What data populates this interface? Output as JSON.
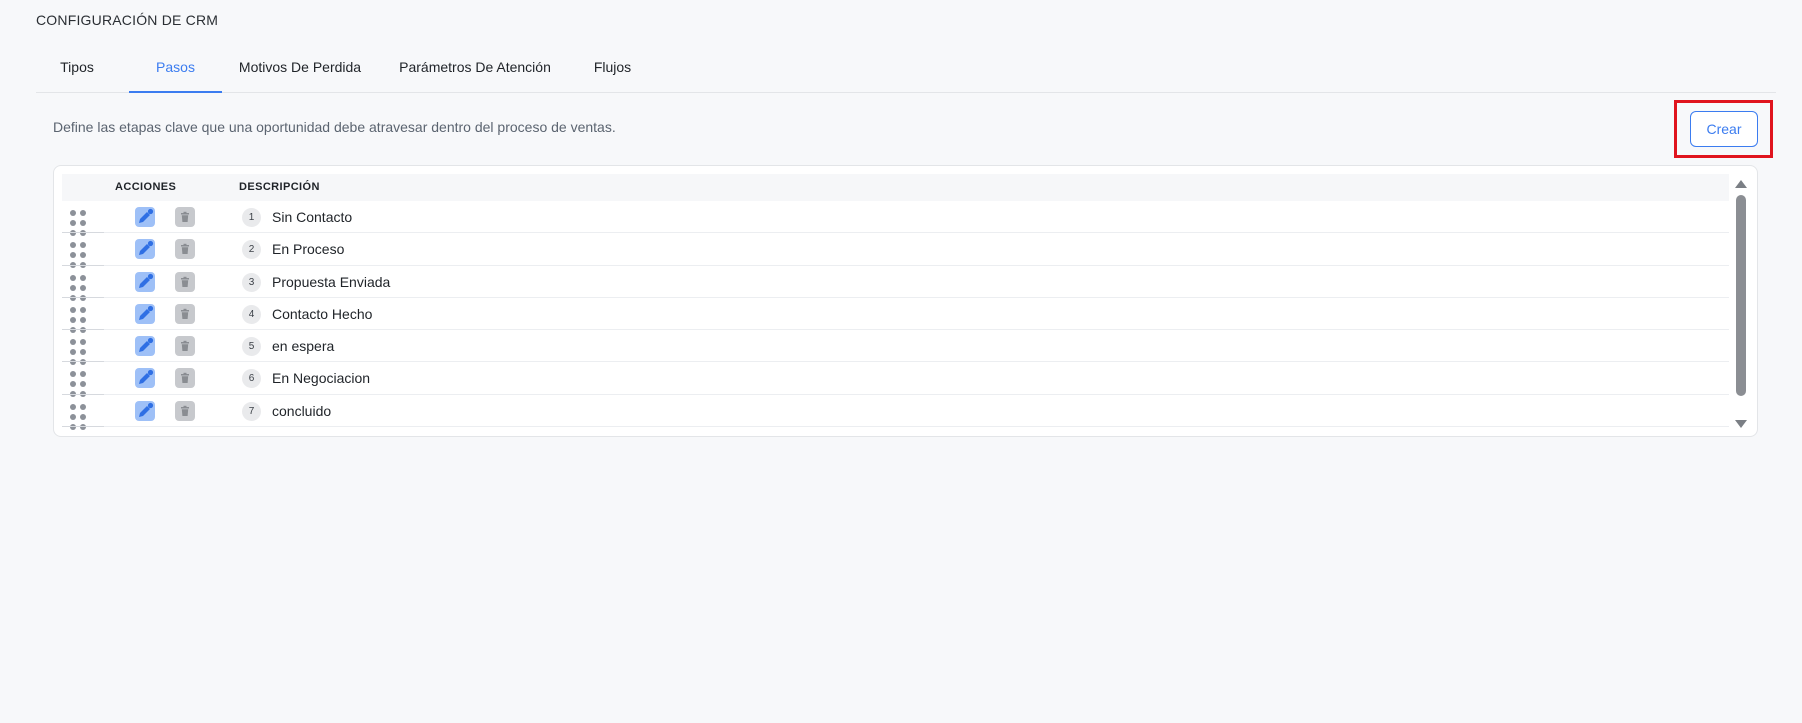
{
  "page": {
    "title": "CONFIGURACIÓN DE CRM",
    "description": "Define las etapas clave que una oportunidad debe atravesar dentro del proceso de ventas."
  },
  "tabs": [
    {
      "label": "Tipos",
      "active": false
    },
    {
      "label": "Pasos",
      "active": true
    },
    {
      "label": "Motivos De Perdida",
      "active": false
    },
    {
      "label": "Parámetros De Atención",
      "active": false
    },
    {
      "label": "Flujos",
      "active": false
    }
  ],
  "toolbar": {
    "create_label": "Crear"
  },
  "table": {
    "headers": {
      "actions": "ACCIONES",
      "description": "DESCRIPCIÓN"
    },
    "rows": [
      {
        "number": "1",
        "label": "Sin Contacto"
      },
      {
        "number": "2",
        "label": "En Proceso"
      },
      {
        "number": "3",
        "label": "Propuesta Enviada"
      },
      {
        "number": "4",
        "label": "Contacto Hecho"
      },
      {
        "number": "5",
        "label": "en espera"
      },
      {
        "number": "6",
        "label": "En Negociacion"
      },
      {
        "number": "7",
        "label": "concluido"
      }
    ]
  },
  "colors": {
    "accent": "#3b7cf0",
    "highlight": "#e0141e",
    "edit_button_bg": "#9ec0f7",
    "delete_button_bg": "#c7c9cd"
  },
  "icons": {
    "drag": "drag-handle-icon",
    "edit": "pencil-icon",
    "delete": "trash-icon"
  }
}
